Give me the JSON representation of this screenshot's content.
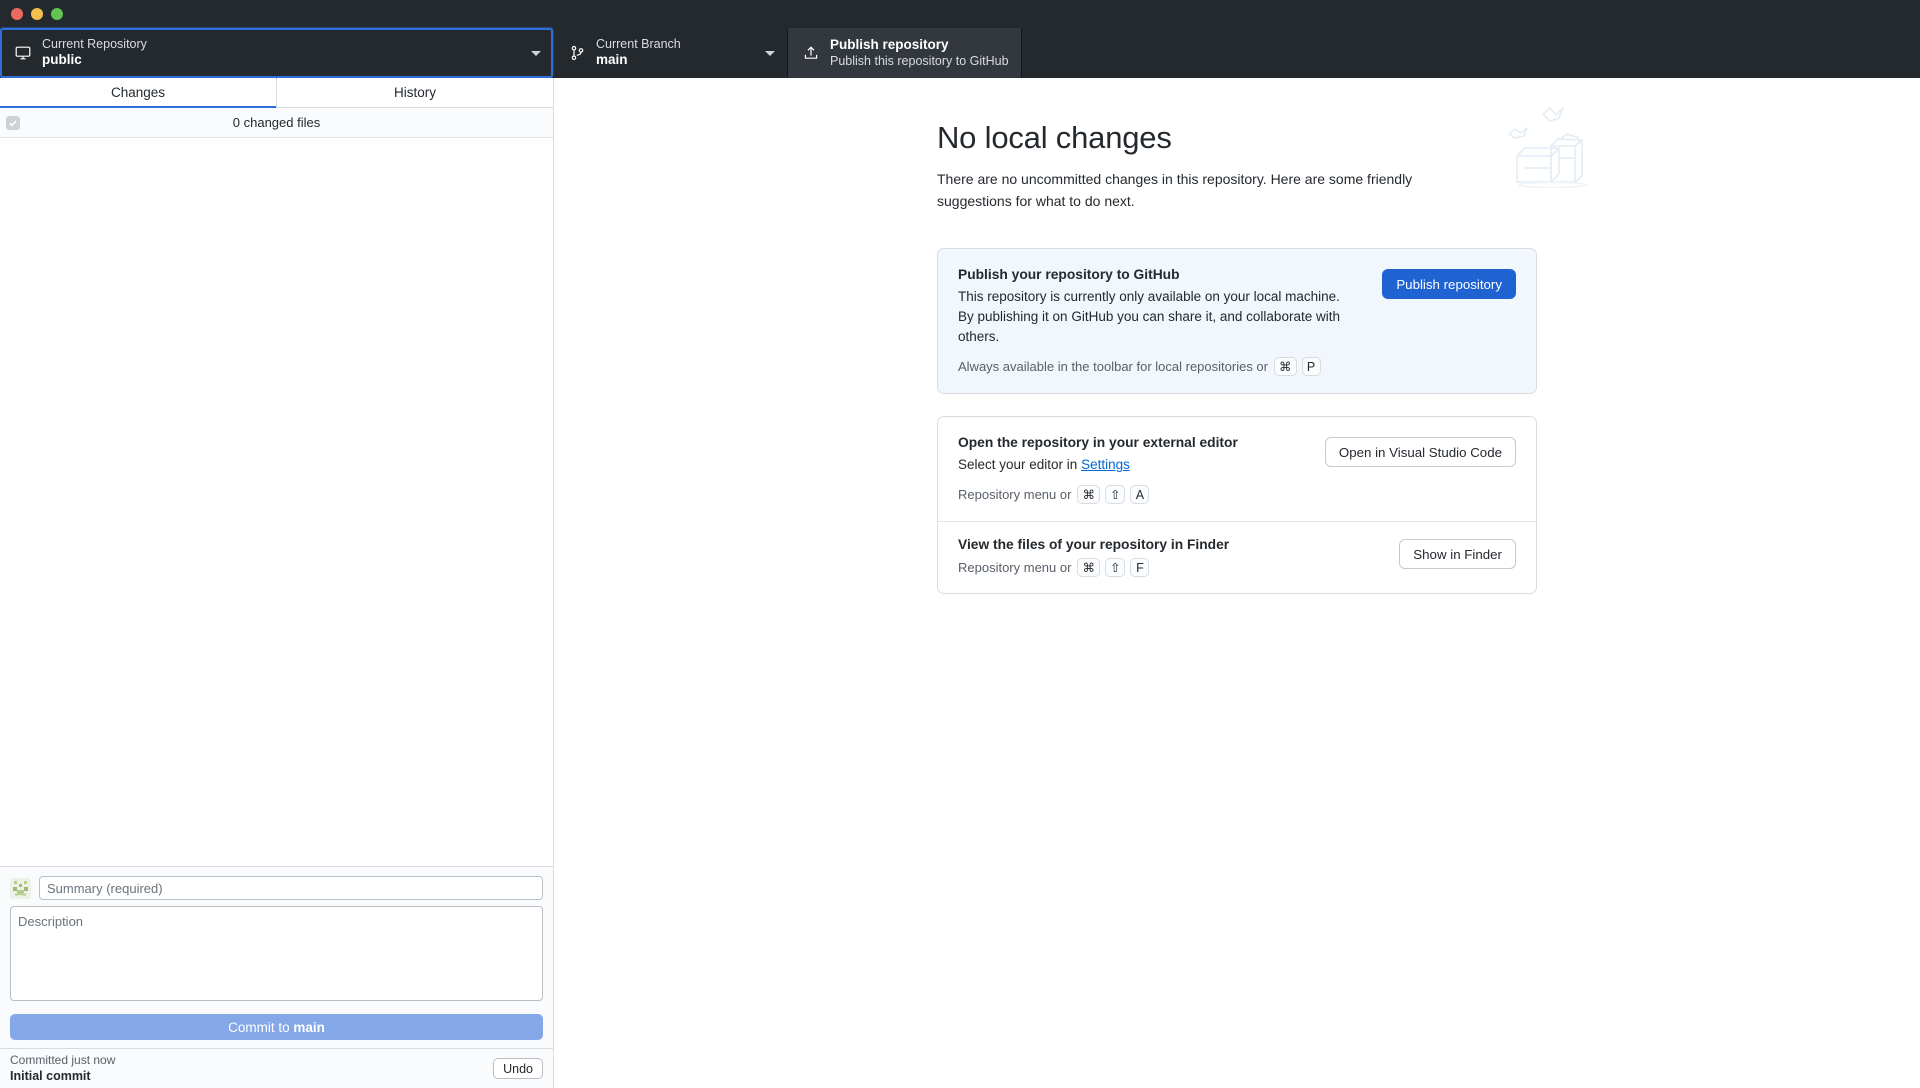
{
  "window": {
    "traffic_lights": [
      "close",
      "minimize",
      "zoom"
    ]
  },
  "toolbar": {
    "repository": {
      "label": "Current Repository",
      "value": "public",
      "icon": "repository-icon"
    },
    "branch": {
      "label": "Current Branch",
      "value": "main",
      "icon": "branch-icon"
    },
    "publish": {
      "title": "Publish repository",
      "subtitle": "Publish this repository to GitHub",
      "icon": "upload-icon"
    }
  },
  "sidebar": {
    "tabs": [
      {
        "label": "Changes",
        "active": true
      },
      {
        "label": "History",
        "active": false
      }
    ],
    "changed_files_text": "0 changed files",
    "commit": {
      "summary_placeholder": "Summary (required)",
      "summary_value": "",
      "description_placeholder": "Description",
      "description_value": "",
      "button_prefix": "Commit to ",
      "button_branch": "main"
    },
    "undo": {
      "when": "Committed just now",
      "message": "Initial commit",
      "button": "Undo"
    }
  },
  "main": {
    "title": "No local changes",
    "description": "There are no uncommitted changes in this repository. Here are some friendly suggestions for what to do next.",
    "cards": [
      {
        "title": "Publish your repository to GitHub",
        "description": "This repository is currently only available on your local machine. By publishing it on GitHub you can share it, and collaborate with others.",
        "meta_prefix": "Always available in the toolbar for local repositories or",
        "keys": [
          "⌘",
          "P"
        ],
        "action": "Publish repository"
      },
      {
        "title": "Open the repository in your external editor",
        "description_prefix": "Select your editor in ",
        "description_link": "Settings",
        "meta_prefix": "Repository menu or",
        "keys": [
          "⌘",
          "⇧",
          "A"
        ],
        "action": "Open in Visual Studio Code"
      },
      {
        "title": "View the files of your repository in Finder",
        "meta_prefix": "Repository menu or",
        "keys": [
          "⌘",
          "⇧",
          "F"
        ],
        "action": "Show in Finder"
      }
    ]
  },
  "colors": {
    "toolbar_bg": "#24292e",
    "accent": "#2e6fd9",
    "primary_button": "#1f63d3",
    "link": "#0366d6",
    "highlight_card_bg": "#f2f7fd",
    "commit_button_disabled": "#84a7e8"
  }
}
